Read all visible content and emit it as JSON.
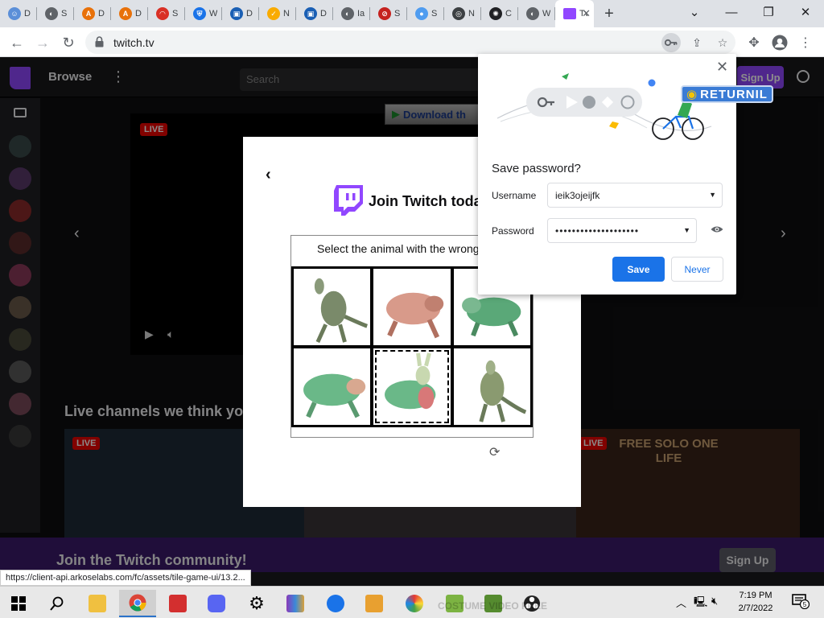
{
  "browser": {
    "tabs": [
      {
        "letter": "D",
        "color": "#5b8fd8",
        "glyph": "☺"
      },
      {
        "letter": "S",
        "color": "#5f6368",
        "glyph": "◐"
      },
      {
        "letter": "D",
        "color": "#e8710a",
        "glyph": "A"
      },
      {
        "letter": "D",
        "color": "#e8710a",
        "glyph": "A"
      },
      {
        "letter": "S",
        "color": "#d93025",
        "glyph": "◠"
      },
      {
        "letter": "W",
        "color": "#1a73e8",
        "glyph": "⛨"
      },
      {
        "letter": "D",
        "color": "#1a5fb4",
        "glyph": "▣"
      },
      {
        "letter": "N",
        "color": "#f9ab00",
        "glyph": "✓"
      },
      {
        "letter": "D",
        "color": "#1a5fb4",
        "glyph": "▣"
      },
      {
        "letter": "Ia",
        "color": "#5f6368",
        "glyph": "◐"
      },
      {
        "letter": "S",
        "color": "#c5221f",
        "glyph": "⊘"
      },
      {
        "letter": "S",
        "color": "#4f9cf0",
        "glyph": "●"
      },
      {
        "letter": "N",
        "color": "#3c4043",
        "glyph": "◎"
      },
      {
        "letter": "C",
        "color": "#202124",
        "glyph": "✺"
      },
      {
        "letter": "W",
        "color": "#5f6368",
        "glyph": "◐"
      }
    ],
    "active_tab": {
      "letter": "Tv",
      "close": "✕"
    },
    "new_tab": "+",
    "window_controls": {
      "dropdown": "⌄",
      "minimize": "—",
      "restore": "❐",
      "close": "✕"
    },
    "url": "twitch.tv"
  },
  "twitch": {
    "browse": "Browse",
    "search_placeholder": "Search",
    "signup": "Sign Up",
    "live": "LIVE",
    "download_banner": "Download th",
    "live_channels": "Live channels we think you",
    "tile_text": "FREE SOLO ONE LIFE",
    "community": "Join the Twitch community!",
    "community_signup": "Sign Up"
  },
  "modal": {
    "back": "‹",
    "title": "Join Twitch toda",
    "captcha_prompt": "Select the animal with the wrong",
    "refresh": "⟳"
  },
  "password_bubble": {
    "close": "✕",
    "title": "Save password?",
    "username_label": "Username",
    "username_value": "ieik3ojeijfk",
    "password_label": "Password",
    "password_value": "••••••••••••••••••••",
    "save": "Save",
    "never": "Never",
    "overlay_badge": "RETURNIL"
  },
  "status_url": "https://client-api.arkoselabs.com/fc/assets/tile-game-ui/13.2...",
  "taskbar": {
    "time": "7:19 PM",
    "date": "2/7/2022",
    "notifications": "5",
    "ghost_text": "COSTUME VIDEO FREE"
  }
}
